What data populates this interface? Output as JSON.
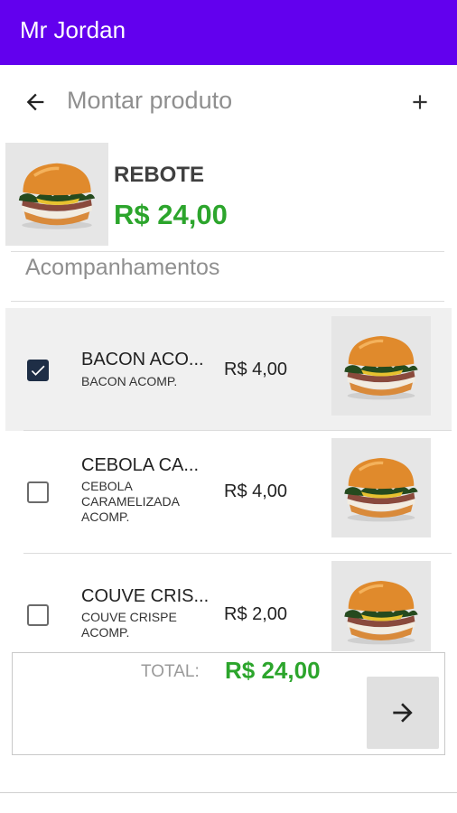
{
  "app": {
    "title": "Mr Jordan"
  },
  "toolbar": {
    "title": "Montar produto"
  },
  "product": {
    "name": "REBOTE",
    "price": "R$ 24,00"
  },
  "section": {
    "title": "Acompanhamentos"
  },
  "items": [
    {
      "name": "BACON ACO...",
      "description": "BACON ACOMP.",
      "price": "R$ 4,00",
      "checked": true
    },
    {
      "name": "CEBOLA CA...",
      "description": "CEBOLA CARAMELIZADA ACOMP.",
      "price": "R$ 4,00",
      "checked": false
    },
    {
      "name": "COUVE CRIS...",
      "description": "COUVE CRISPE ACOMP.",
      "price": "R$ 2,00",
      "checked": false
    }
  ],
  "footer": {
    "total_label": "TOTAL:",
    "total_value": "R$ 24,00"
  },
  "colors": {
    "app_bar": "#6200ee",
    "price_green": "#2ca52c",
    "checkbox_checked": "#1e2e46"
  },
  "icons": {
    "back": "arrow-left-icon",
    "add": "plus-icon",
    "next": "arrow-right-icon"
  }
}
